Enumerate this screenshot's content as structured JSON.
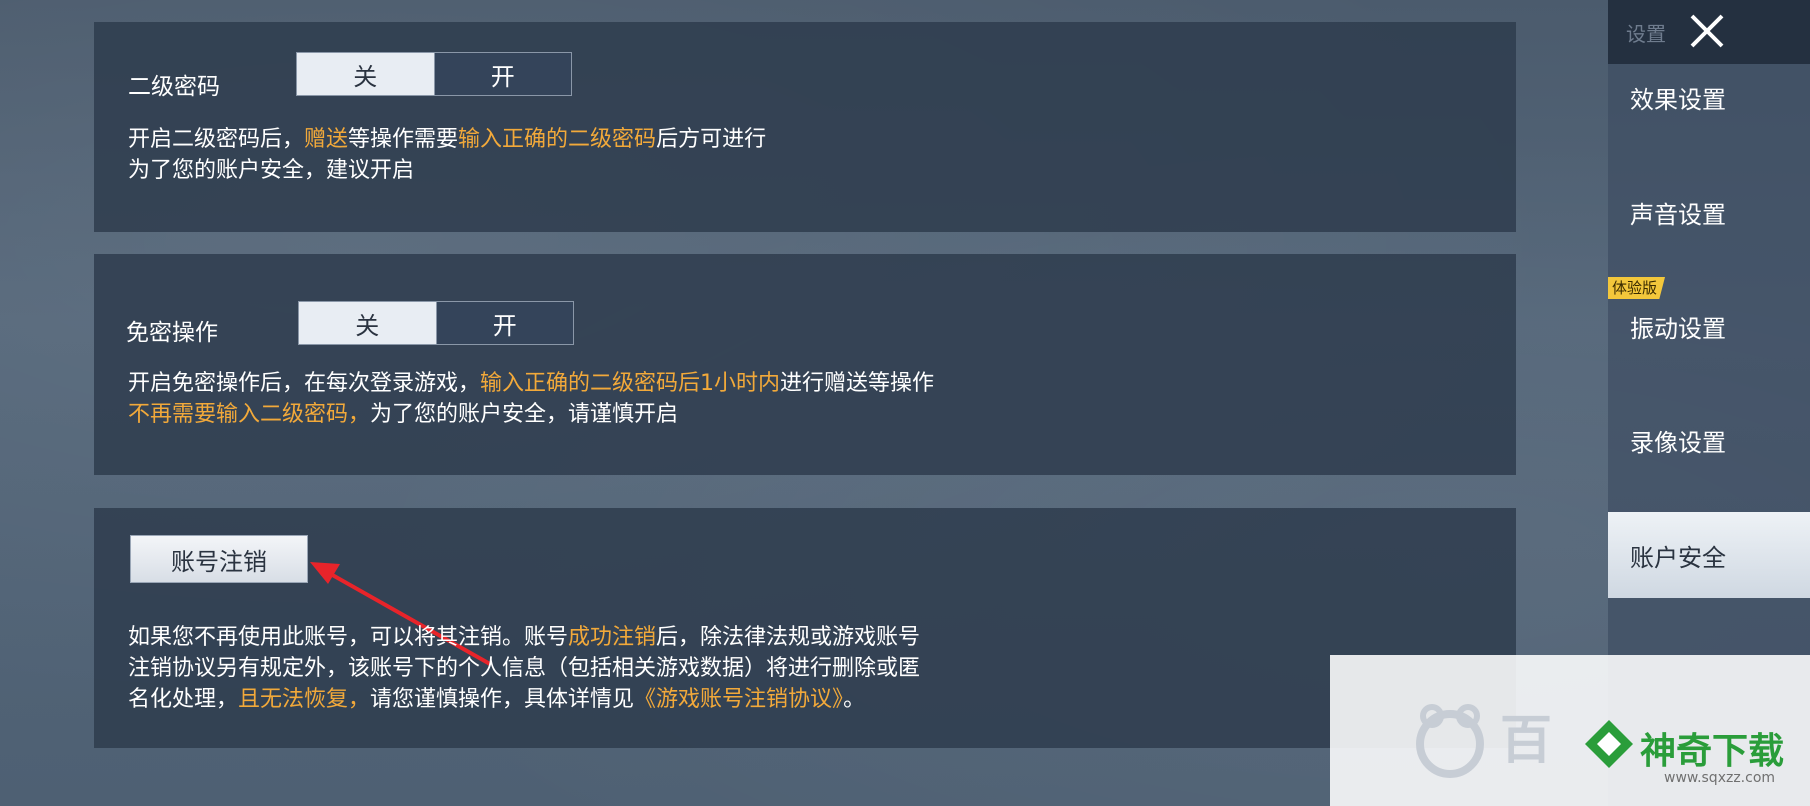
{
  "colors": {
    "highlight": "#f2a93a",
    "panel": "#2e3c4e",
    "brand": "#2a9d3a"
  },
  "sections": {
    "second_password": {
      "label": "二级密码",
      "toggle": {
        "off": "关",
        "on": "开",
        "selected": "off"
      },
      "desc": {
        "l1_a": "开启二级密码后，",
        "l1_b": "赠送",
        "l1_c": "等操作需要",
        "l1_d": "输入正确的二级密码",
        "l1_e": "后方可进行",
        "l2": "为了您的账户安全，建议开启"
      }
    },
    "passwordless": {
      "label": "免密操作",
      "toggle": {
        "off": "关",
        "on": "开",
        "selected": "off"
      },
      "desc": {
        "l1_a": "开启免密操作后，在每次登录游戏，",
        "l1_b": "输入正确的二级密码后1小时内",
        "l1_c": "进行赠送等操作",
        "l2_a": "不再需要输入二级密码，",
        "l2_b": "为了您的账户安全，请谨慎开启"
      }
    },
    "deactivate": {
      "button": "账号注销",
      "desc": {
        "l1_a": "如果您不再使用此账号，可以将其注销。账号",
        "l1_b": "成功注销",
        "l1_c": "后，除法律法规或游戏账号",
        "l2": "注销协议另有规定外，该账号下的个人信息（包括相关游戏数据）将进行删除或匿",
        "l3_a": "名化处理，",
        "l3_b": "且无法恢复，",
        "l3_c": "请您谨慎操作，具体详情见",
        "l3_d": "《游戏账号注销协议》",
        "l3_e": "。"
      }
    }
  },
  "sidebar": {
    "header": "设置",
    "badge": "体验版",
    "items": [
      {
        "label": "效果设置"
      },
      {
        "label": "声音设置"
      },
      {
        "label": "振动设置"
      },
      {
        "label": "录像设置"
      },
      {
        "label": "账户安全",
        "active": true
      }
    ]
  },
  "watermark": {
    "left_text": "百",
    "brand": "神奇下载",
    "url": "www.sqxzz.com"
  }
}
